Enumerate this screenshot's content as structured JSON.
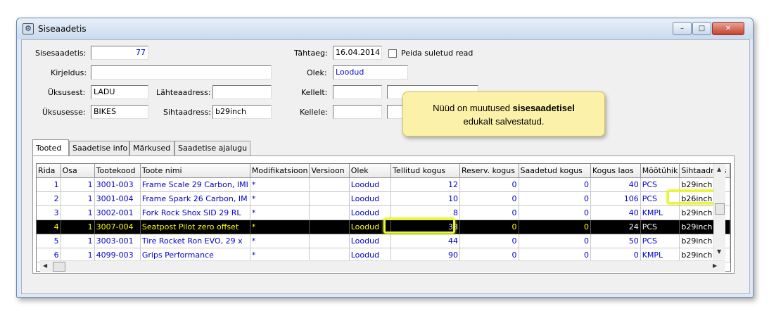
{
  "window": {
    "title": "Siseaadetis",
    "buttons": {
      "minimize": "–",
      "maximize": "□",
      "close": "✕"
    }
  },
  "form": {
    "sisesaadetis": {
      "label": "Sisesaadetis:",
      "value": "77"
    },
    "kirjeldus": {
      "label": "Kirjeldus:",
      "value": ""
    },
    "uksusest": {
      "label": "Üksusest:",
      "value": "LADU"
    },
    "lahteaadress": {
      "label": "Lähteaadress:",
      "value": ""
    },
    "uksusesse": {
      "label": "Üksusesse:",
      "value": "BIKES"
    },
    "sihtaadress": {
      "label": "Sihtaadress:",
      "value": "b29inch"
    },
    "tahtaeg": {
      "label": "Tähtaeg:",
      "value": "16.04.2014"
    },
    "peida": {
      "label": "Peida suletud read"
    },
    "olek": {
      "label": "Olek:",
      "value": "Loodud"
    },
    "kellelt": {
      "label": "Kellelt:",
      "value": ""
    },
    "kellele": {
      "label": "Kellele:",
      "value": ""
    }
  },
  "tooltip": {
    "pre": "Nüüd on muutused ",
    "bold": "sisesaadetisel",
    "post": "edukalt salvestatud."
  },
  "tabs": [
    {
      "label": "Tooted"
    },
    {
      "label": "Saadetise info"
    },
    {
      "label": "Märkused"
    },
    {
      "label": "Saadetise ajalugu"
    }
  ],
  "grid": {
    "columns": [
      "Rida",
      "Osa",
      "Tootekood",
      "Toote nimi",
      "Modifikatsioon",
      "Versioon",
      "Olek",
      "Tellitud kogus",
      "Reserv. kogus",
      "Saadetud kogus",
      "Kogus laos",
      "Mõõtühik",
      "Sihtaadress"
    ],
    "rows": [
      [
        "1",
        "1",
        "3001-003",
        "Frame Scale 29 Carbon, IMI",
        "*",
        "",
        "Loodud",
        "12",
        "0",
        "0",
        "40",
        "PCS",
        "b29inch"
      ],
      [
        "2",
        "1",
        "3001-004",
        "Frame Spark 26 Carbon, IM",
        "*",
        "",
        "Loodud",
        "10",
        "0",
        "0",
        "106",
        "PCS",
        "b26inch"
      ],
      [
        "3",
        "1",
        "3002-001",
        "Fork Rock Shox SID 29 RL",
        "*",
        "",
        "Loodud",
        "8",
        "0",
        "0",
        "40",
        "KMPL",
        "b29inch"
      ],
      [
        "4",
        "1",
        "3007-004",
        "Seatpost Pilot zero offset",
        "*",
        "",
        "Loodud",
        "38",
        "0",
        "0",
        "24",
        "PCS",
        "b29inch"
      ],
      [
        "5",
        "1",
        "3003-001",
        "Tire Rocket Ron EVO, 29 x",
        "*",
        "",
        "Loodud",
        "44",
        "0",
        "0",
        "50",
        "PCS",
        "b29inch"
      ],
      [
        "6",
        "1",
        "4099-003",
        "Grips Performance",
        "*",
        "",
        "Loodud",
        "90",
        "0",
        "0",
        "0",
        "KMPL",
        "b29inch"
      ]
    ],
    "selected_row_index": 3
  },
  "colors": {
    "link_text": "#0000cc",
    "selected_bg": "#000000",
    "selected_text": "#ffff00",
    "highlight": "#e9f53b",
    "tooltip_bg": "#fbf1a8"
  }
}
